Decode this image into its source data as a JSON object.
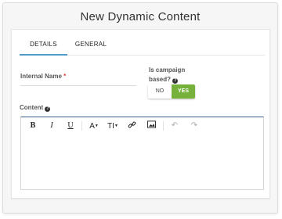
{
  "modal": {
    "title": "New Dynamic Content"
  },
  "tabs": [
    {
      "label": "DETAILS",
      "active": true
    },
    {
      "label": "GENERAL",
      "active": false
    }
  ],
  "form": {
    "internal_name": {
      "label": "Internal Name",
      "required_mark": "*",
      "value": ""
    },
    "campaign_based": {
      "label_line1": "Is campaign",
      "label_line2": "based?",
      "help_icon": "question-circle-icon",
      "options": [
        "NO",
        "YES"
      ],
      "selected": "YES"
    },
    "content": {
      "label": "Content",
      "help_icon": "question-circle-icon"
    }
  },
  "toolbar": {
    "bold": "B",
    "italic": "I",
    "underline": "U",
    "font_color": "A",
    "font_size": "TI",
    "link_icon": "link-icon",
    "image_icon": "image-icon",
    "undo_icon": "undo-icon",
    "redo_icon": "redo-icon"
  },
  "colors": {
    "accent_tab": "#4e9ac9",
    "toggle_active": "#76b23b",
    "required": "#e0413a",
    "editor_top_border": "#3c5f8c"
  }
}
